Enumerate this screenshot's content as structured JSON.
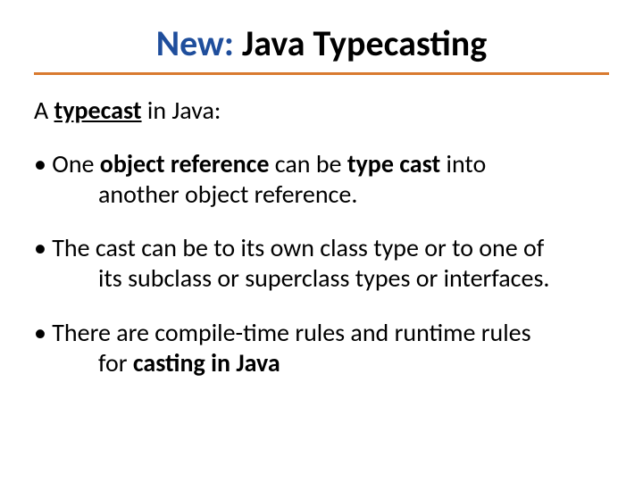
{
  "title": {
    "new_prefix": "New:",
    "rest": " Java Typecasting"
  },
  "intro": {
    "pre": "A ",
    "keyword": "typecast",
    "post": " in Java:"
  },
  "bullets": [
    {
      "line1_pre": "• One ",
      "line1_b1": "object reference",
      "line1_mid": " can be ",
      "line1_b2": "type cast",
      "line1_post": " into",
      "cont": "another object reference."
    },
    {
      "line1": "• The cast can be to its own class type or to one of",
      "cont": "its subclass or superclass types or interfaces."
    },
    {
      "line1": "• There are compile-time rules and runtime rules",
      "cont_pre": "for ",
      "cont_b": "casting in Java"
    }
  ]
}
